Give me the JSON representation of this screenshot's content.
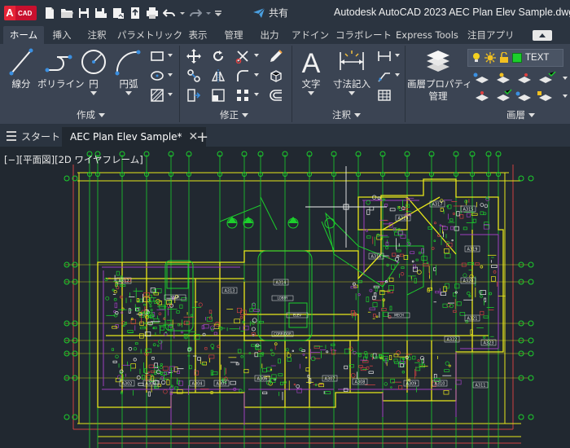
{
  "app": {
    "badge_letter": "A",
    "badge_text": "CAD",
    "title": "Autodesk AutoCAD 2023    AEC Plan Elev Sample.dwg",
    "share_label": "共有"
  },
  "quick_access": [
    {
      "icon": "new-file-icon"
    },
    {
      "icon": "open-folder-icon"
    },
    {
      "icon": "save-icon"
    },
    {
      "icon": "save-as-icon"
    },
    {
      "icon": "upload-icon"
    },
    {
      "icon": "save-web-icon"
    },
    {
      "icon": "print-icon"
    },
    {
      "icon": "undo-icon"
    },
    {
      "icon": "redo-icon"
    },
    {
      "icon": "customize-qat-icon"
    }
  ],
  "ribbon_tabs": [
    {
      "label": "ホーム",
      "active": true
    },
    {
      "label": "挿入"
    },
    {
      "label": "注釈"
    },
    {
      "label": "パラメトリック"
    },
    {
      "label": "表示"
    },
    {
      "label": "管理"
    },
    {
      "label": "出力"
    },
    {
      "label": "アドイン"
    },
    {
      "label": "コラボレート"
    },
    {
      "label": "Express Tools"
    },
    {
      "label": "注目アプリ"
    }
  ],
  "ribbon": {
    "draw": {
      "title": "作成",
      "line": "線分",
      "polyline": "ポリライン",
      "circle": "円",
      "arc": "円弧"
    },
    "modify": {
      "title": "修正"
    },
    "annotation": {
      "title": "注釈",
      "text": "文字",
      "dimension": "寸法記入"
    },
    "layers": {
      "title": "画層",
      "properties_line1": "画層プロパティ",
      "properties_line2": "管理",
      "current_layer": "TEXT",
      "current_layer_color": "#1ccf2c"
    }
  },
  "doc_tabs": [
    {
      "label": "スタート"
    },
    {
      "label": "AEC Plan Elev Sample*",
      "active": true
    }
  ],
  "viewport": {
    "label": "[−][平面図][2D ワイヤフレーム]",
    "rooms": [
      "A316",
      "A315",
      "A317",
      "A318",
      "A319",
      "A320",
      "A312",
      "A313",
      "A314",
      "A321",
      "A322",
      "A323",
      "A302",
      "A303",
      "A304",
      "A305",
      "A306",
      "A307",
      "A308",
      "A309",
      "A310",
      "A311"
    ],
    "room_small_labels": [
      "LOBBY",
      "CORRIDOR",
      "STAIR",
      "ELEV",
      "MECH"
    ]
  },
  "colors": {
    "background": "#212830",
    "ribbon": "#3b4453",
    "titlebar": "#2b3440",
    "accent_red": "#c8102e",
    "cad_yellow": "#e8e81a",
    "cad_green": "#1ccf2c",
    "cad_purple": "#a040c0",
    "cad_red": "#d04040"
  }
}
